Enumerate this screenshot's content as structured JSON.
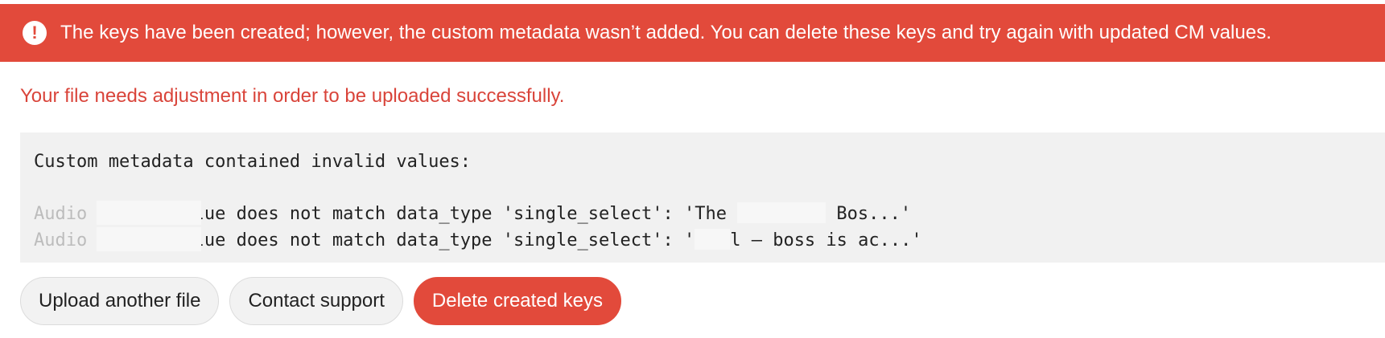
{
  "banner": {
    "icon": "exclamation-circle-icon",
    "message": "The keys have been created; however, the custom metadata wasn’t added. You can delete these keys and try again with updated CM values.",
    "background_color": "#e24a3b"
  },
  "error_title": "Your file needs adjustment in order to be uploaded successfully.",
  "code_block": {
    "header": "Custom metadata contained invalid values:",
    "lines": [
      {
        "prefix": "Audio State",
        "middle": ": value does not match data_type 'single_select': 'The ",
        "suffix": " Bos...'"
      },
      {
        "prefix": "Audio State",
        "middle": ": value does not match data_type 'single_select': '",
        "suffix": "l – boss is ac...'"
      }
    ]
  },
  "actions": {
    "upload_label": "Upload another file",
    "contact_label": "Contact support",
    "delete_label": "Delete created keys"
  }
}
